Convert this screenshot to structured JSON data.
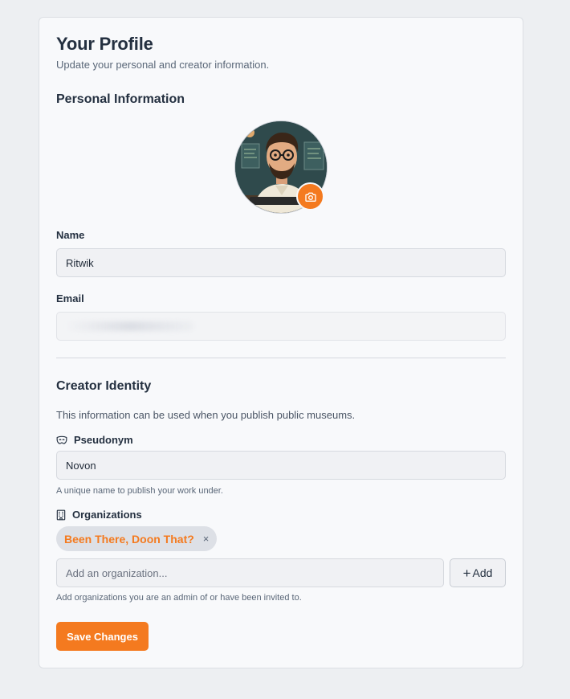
{
  "header": {
    "title": "Your Profile",
    "subtitle": "Update your personal and creator information."
  },
  "personal": {
    "section_title": "Personal Information",
    "name_label": "Name",
    "name_value": "Ritwik",
    "email_label": "Email",
    "email_value": ""
  },
  "creator": {
    "section_title": "Creator Identity",
    "description": "This information can be used when you publish public museums.",
    "pseudonym_label": "Pseudonym",
    "pseudonym_value": "Novon",
    "pseudonym_help": "A unique name to publish your work under.",
    "organizations_label": "Organizations",
    "organizations": [
      "Been There, Doon That?"
    ],
    "org_remove_symbol": "×",
    "org_input_placeholder": "Add an organization...",
    "add_button_label": "Add",
    "add_button_icon": "+",
    "org_help": "Add organizations you are an admin of or have been invited to."
  },
  "actions": {
    "save_label": "Save Changes"
  },
  "icons": {
    "camera": "camera-icon",
    "mask": "mask-icon",
    "building": "building-icon",
    "remove": "close-icon",
    "plus": "plus-icon"
  },
  "colors": {
    "accent": "#f47a1f",
    "background": "#edeff2",
    "card": "#f8f9fb",
    "text": "#243040",
    "muted": "#5a6778"
  }
}
